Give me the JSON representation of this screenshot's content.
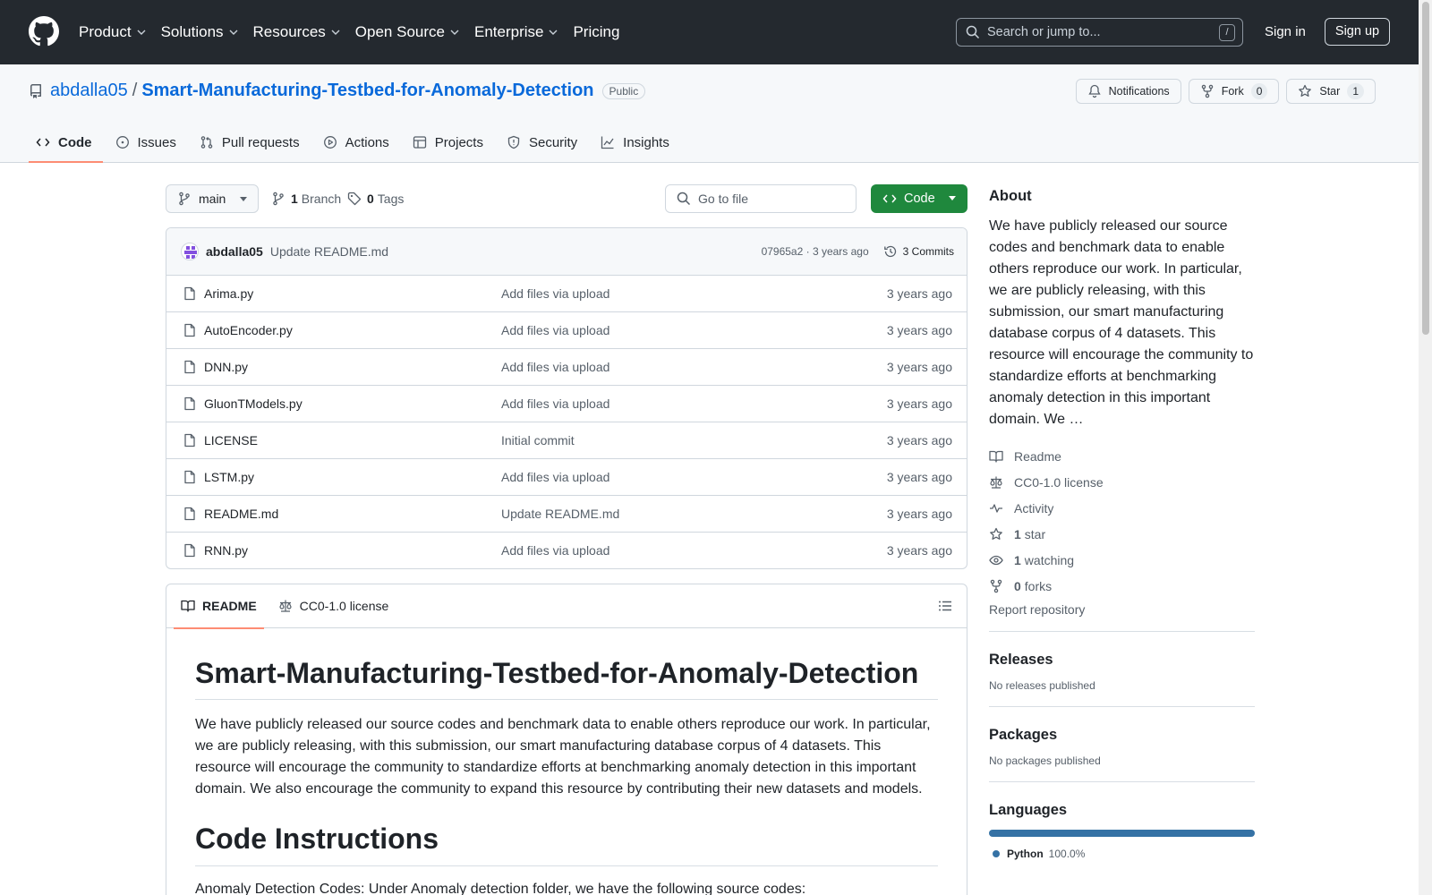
{
  "header": {
    "nav": [
      "Product",
      "Solutions",
      "Resources",
      "Open Source",
      "Enterprise",
      "Pricing"
    ],
    "search_placeholder": "Search or jump to...",
    "search_shortcut": "/",
    "signin": "Sign in",
    "signup": "Sign up"
  },
  "repo": {
    "owner": "abdalla05",
    "separator": "/",
    "name": "Smart-Manufacturing-Testbed-for-Anomaly-Detection",
    "visibility": "Public",
    "notifications_label": "Notifications",
    "fork_label": "Fork",
    "fork_count": "0",
    "star_label": "Star",
    "star_count": "1",
    "tabs": [
      "Code",
      "Issues",
      "Pull requests",
      "Actions",
      "Projects",
      "Security",
      "Insights"
    ]
  },
  "toolbar": {
    "branch": "main",
    "branch_count": "1",
    "branch_label": "Branch",
    "tag_count": "0",
    "tag_label": "Tags",
    "gofile_placeholder": "Go to file",
    "code_label": "Code"
  },
  "commit": {
    "author": "abdalla05",
    "message": "Update README.md",
    "meta": "07965a2 · 3 years ago",
    "commits": "3 Commits"
  },
  "files": [
    {
      "name": "Arima.py",
      "message": "Add files via upload",
      "date": "3 years ago"
    },
    {
      "name": "AutoEncoder.py",
      "message": "Add files via upload",
      "date": "3 years ago"
    },
    {
      "name": "DNN.py",
      "message": "Add files via upload",
      "date": "3 years ago"
    },
    {
      "name": "GluonTModels.py",
      "message": "Add files via upload",
      "date": "3 years ago"
    },
    {
      "name": "LICENSE",
      "message": "Initial commit",
      "date": "3 years ago"
    },
    {
      "name": "LSTM.py",
      "message": "Add files via upload",
      "date": "3 years ago"
    },
    {
      "name": "README.md",
      "message": "Update README.md",
      "date": "3 years ago"
    },
    {
      "name": "RNN.py",
      "message": "Add files via upload",
      "date": "3 years ago"
    }
  ],
  "readme": {
    "tab_readme": "README",
    "tab_license": "CC0-1.0 license",
    "title": "Smart-Manufacturing-Testbed-for-Anomaly-Detection",
    "paragraph": "We have publicly released our source codes and benchmark data to enable others reproduce our work. In particular, we are publicly releasing, with this submission, our smart manufacturing database corpus of 4 datasets. This resource will encourage the community to standardize efforts at benchmarking anomaly detection in this important domain. We also encourage the community to expand this resource by contributing their new datasets and models.",
    "heading2": "Code Instructions",
    "partial_line": "Anomaly Detection Codes: Under Anomaly detection folder, we have the following source codes:"
  },
  "about": {
    "title": "About",
    "description": "We have publicly released our source codes and benchmark data to enable others reproduce our work. In particular, we are publicly releasing, with this submission, our smart manufacturing database corpus of 4 datasets. This resource will encourage the community to standardize efforts at benchmarking anomaly detection in this important domain. We …",
    "readme": "Readme",
    "license": "CC0-1.0 license",
    "activity": "Activity",
    "stars_count": "1",
    "stars_label": "star",
    "watching_count": "1",
    "watching_label": "watching",
    "forks_count": "0",
    "forks_label": "forks",
    "report": "Report repository"
  },
  "releases": {
    "title": "Releases",
    "empty": "No releases published"
  },
  "packages": {
    "title": "Packages",
    "empty": "No packages published"
  },
  "languages": {
    "title": "Languages",
    "items": [
      {
        "name": "Python",
        "percent": "100.0%",
        "color": "#3572a5"
      }
    ]
  },
  "colors": {
    "header_bg": "#24292f",
    "link": "#0969da",
    "primary_button": "#1f883d",
    "tab_underline": "#fd8c73"
  }
}
